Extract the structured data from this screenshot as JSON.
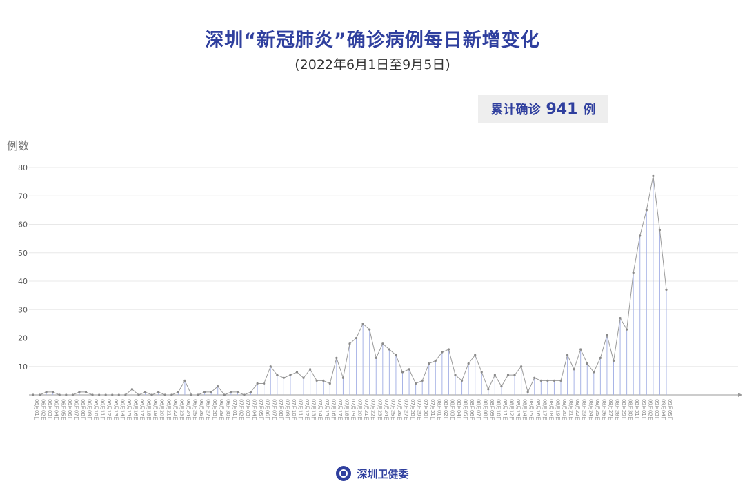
{
  "header": {
    "title": "深圳“新冠肺炎”确诊病例每日新增变化",
    "subtitle": "(2022年6月1日至9月5日)"
  },
  "summary": {
    "label_prefix": "累计确诊",
    "total": "941",
    "label_suffix": "例"
  },
  "footer": {
    "org_name": "深圳卫健委"
  },
  "colors": {
    "title": "#2f3f9e",
    "line": "#9a9a9a",
    "drop_line": "#a8b4e6"
  },
  "chart_data": {
    "type": "line",
    "ylabel": "例数",
    "ylim": [
      0,
      80
    ],
    "yticks": [
      10,
      20,
      30,
      40,
      50,
      60,
      70,
      80
    ],
    "grid": true,
    "x": [
      "06月01日",
      "06月02日",
      "06月03日",
      "06月04日",
      "06月05日",
      "06月06日",
      "06月07日",
      "06月08日",
      "06月09日",
      "06月10日",
      "06月11日",
      "06月12日",
      "06月13日",
      "06月14日",
      "06月15日",
      "06月16日",
      "06月17日",
      "06月18日",
      "06月19日",
      "06月20日",
      "06月21日",
      "06月22日",
      "06月23日",
      "06月24日",
      "06月25日",
      "06月26日",
      "06月27日",
      "06月28日",
      "06月29日",
      "06月30日",
      "07月01日",
      "07月02日",
      "07月03日",
      "07月04日",
      "07月05日",
      "07月06日",
      "07月07日",
      "07月08日",
      "07月09日",
      "07月10日",
      "07月11日",
      "07月12日",
      "07月13日",
      "07月14日",
      "07月15日",
      "07月16日",
      "07月17日",
      "07月18日",
      "07月19日",
      "07月20日",
      "07月21日",
      "07月22日",
      "07月23日",
      "07月24日",
      "07月25日",
      "07月26日",
      "07月27日",
      "07月28日",
      "07月29日",
      "07月30日",
      "07月31日",
      "08月01日",
      "08月02日",
      "08月03日",
      "08月04日",
      "08月05日",
      "08月06日",
      "08月07日",
      "08月08日",
      "08月09日",
      "08月10日",
      "08月11日",
      "08月12日",
      "08月13日",
      "08月14日",
      "08月15日",
      "08月16日",
      "08月17日",
      "08月18日",
      "08月19日",
      "08月20日",
      "08月21日",
      "08月22日",
      "08月23日",
      "08月24日",
      "08月25日",
      "08月26日",
      "08月27日",
      "08月28日",
      "08月29日",
      "08月30日",
      "08月31日",
      "09月01日",
      "09月02日",
      "09月03日",
      "09月04日",
      "09月05日"
    ],
    "values": [
      0,
      0,
      1,
      1,
      0,
      0,
      0,
      1,
      1,
      0,
      0,
      0,
      0,
      0,
      0,
      2,
      0,
      1,
      0,
      1,
      0,
      0,
      1,
      5,
      0,
      0,
      1,
      1,
      3,
      0,
      1,
      1,
      0,
      1,
      4,
      4,
      10,
      7,
      6,
      7,
      8,
      6,
      9,
      5,
      5,
      4,
      13,
      6,
      18,
      20,
      25,
      23,
      13,
      18,
      16,
      14,
      8,
      9,
      4,
      5,
      11,
      12,
      15,
      16,
      7,
      5,
      11,
      14,
      8,
      2,
      7,
      3,
      7,
      7,
      10,
      1,
      6,
      5,
      5,
      5,
      5,
      14,
      9,
      16,
      11,
      8,
      13,
      21,
      12,
      27,
      23,
      43,
      56,
      65,
      77,
      58,
      37
    ]
  }
}
